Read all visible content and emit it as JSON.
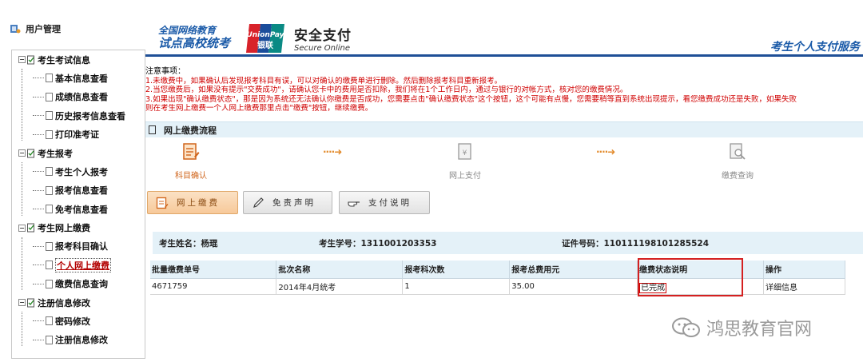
{
  "sidebar": {
    "title": "用户管理",
    "groups": [
      {
        "label": "考生考试信息",
        "items": [
          "基本信息查看",
          "成绩信息查看",
          "历史报考信息查看",
          "打印准考证"
        ]
      },
      {
        "label": "考生报考",
        "items": [
          "考生个人报考",
          "报考信息查看",
          "免考信息查看"
        ]
      },
      {
        "label": "考生网上缴费",
        "items": [
          "报考科目确认",
          "个人网上缴费",
          "缴费信息查询"
        ]
      },
      {
        "label": "注册信息修改",
        "items": [
          "密码修改",
          "注册信息修改"
        ]
      }
    ]
  },
  "header": {
    "logo_line1": "全国网络教育",
    "logo_line2": "试点高校统考",
    "unionpay_en": "UnionPay",
    "unionpay_cn": "银联",
    "secure_cn": "安全支付",
    "secure_en": "Secure Online",
    "right_title": "考生个人支付服务"
  },
  "notices": {
    "title": "注意事项：",
    "items": [
      "1.未缴费中，如果确认后发现报考科目有误，可以对确认的缴费单进行删除。然后删除报考科目重新报考。",
      "2.当您缴费后，如果没有提示\"交费成功\"，请确认您卡中的费用是否扣除，我们将在1个工作日内，通过与银行的对帐方式，核对您的缴费情况。",
      "3.如果出现\"确认缴费状态\"，那是因为系统还无法确认你缴费是否成功，您需要点击\"确认缴费状态\"这个按钮，这个可能有点慢，您需要稍等直到系统出现提示，看您缴费成功还是失败，如果失败",
      "则在考生网上缴费一个人网上缴费那里点击\"缴费\"按钮，继续缴费。"
    ]
  },
  "section": {
    "title": "网上缴费流程"
  },
  "steps": [
    {
      "label": "科目确认"
    },
    {
      "label": "网上支付"
    },
    {
      "label": "缴费查询"
    }
  ],
  "arrow_glyph": "····➜",
  "buttons": {
    "pay": "网上缴费",
    "disclaimer": "免责声明",
    "instructions": "支付说明"
  },
  "student": {
    "name": "考生姓名：杨琨",
    "student_id": "考生学号：1311001203353",
    "id_number": "证件号码：110111198101285524"
  },
  "table": {
    "headers": [
      "批量缴费单号",
      "批次名称",
      "报考科次数",
      "报考总费用元",
      "缴费状态说明",
      "操作"
    ],
    "rows": [
      [
        "4671759",
        "2014年4月统考",
        "1",
        "35.00",
        "已完成",
        "详细信息"
      ]
    ]
  },
  "watermark": {
    "text": "鸿思教育官网"
  },
  "colors": {
    "brand_blue": "#1a5aa8",
    "notice_red": "#d00000",
    "highlight_red": "#d42020",
    "section_bg": "#e4f1f8",
    "step_active": "#d0641a"
  }
}
